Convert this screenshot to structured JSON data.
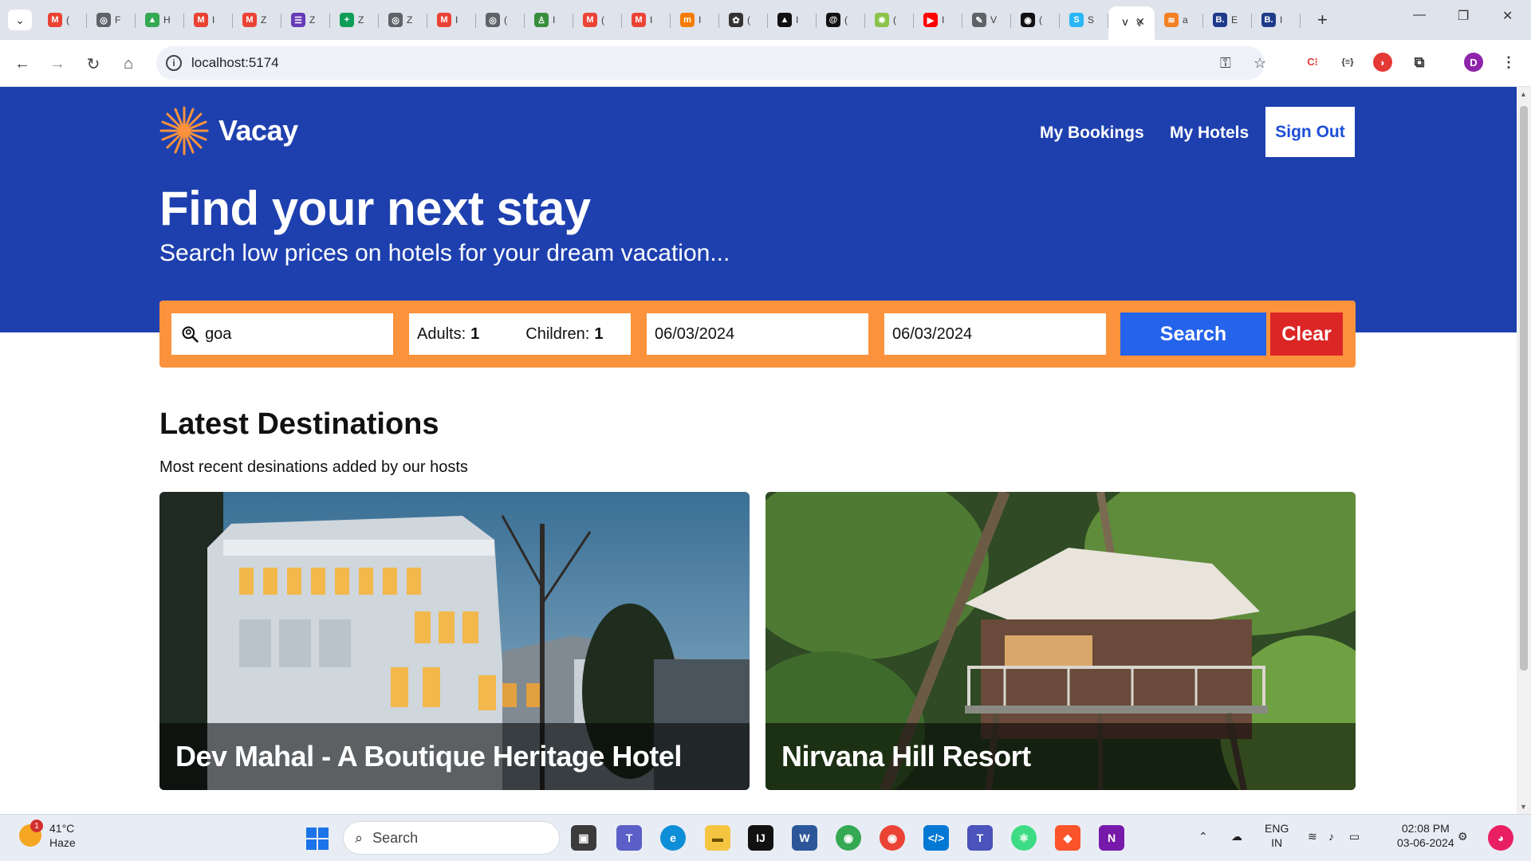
{
  "browser": {
    "tabs": [
      {
        "icon": "gmail-icon",
        "letter": "M",
        "label": "(",
        "color": "#ea4335"
      },
      {
        "icon": "globe-icon",
        "letter": "◎",
        "label": "F",
        "color": "#5f6368"
      },
      {
        "icon": "drive-icon",
        "letter": "▲",
        "label": "H",
        "color": "#34a853"
      },
      {
        "icon": "gmail-icon",
        "letter": "M",
        "label": "I",
        "color": "#ea4335"
      },
      {
        "icon": "gmail-icon",
        "letter": "M",
        "label": "Z",
        "color": "#ea4335"
      },
      {
        "icon": "forms-icon",
        "letter": "☰",
        "label": "Z",
        "color": "#673ab7"
      },
      {
        "icon": "sheets-icon",
        "letter": "+",
        "label": "Z",
        "color": "#0f9d58"
      },
      {
        "icon": "globe-icon",
        "letter": "◎",
        "label": "Z",
        "color": "#5f6368"
      },
      {
        "icon": "gmail-icon",
        "letter": "M",
        "label": "I",
        "color": "#ea4335"
      },
      {
        "icon": "globe-icon",
        "letter": "◎",
        "label": "(",
        "color": "#5f6368"
      },
      {
        "icon": "bag-icon",
        "letter": "♙",
        "label": "I",
        "color": "#388e3c"
      },
      {
        "icon": "gmail-icon",
        "letter": "M",
        "label": "(",
        "color": "#ea4335"
      },
      {
        "icon": "gmail-icon",
        "letter": "M",
        "label": "I",
        "color": "#ea4335"
      },
      {
        "icon": "scaler-icon",
        "letter": "m",
        "label": "I",
        "color": "#f57c00"
      },
      {
        "icon": "openai-icon",
        "letter": "✿",
        "label": "(",
        "color": "#333333"
      },
      {
        "icon": "vercel-icon",
        "letter": "▲",
        "label": "I",
        "color": "#111111"
      },
      {
        "icon": "threads-icon",
        "letter": "@",
        "label": "(",
        "color": "#111111"
      },
      {
        "icon": "leaf-icon",
        "letter": "❋",
        "label": "(",
        "color": "#8bc34a"
      },
      {
        "icon": "youtube-icon",
        "letter": "▶",
        "label": "I",
        "color": "#ff0000"
      },
      {
        "icon": "edit-icon",
        "letter": "✎",
        "label": "V",
        "color": "#5f6368"
      },
      {
        "icon": "github-icon",
        "letter": "◉",
        "label": "(",
        "color": "#111111"
      },
      {
        "icon": "stripe-icon",
        "letter": "S",
        "label": "S",
        "color": "#29b6f6"
      },
      {
        "icon": "vacay-icon",
        "letter": "V",
        "label": "V",
        "color": "#ffffff"
      },
      {
        "icon": "stack-icon",
        "letter": "≋",
        "label": "a",
        "color": "#f48024"
      },
      {
        "icon": "booking-icon",
        "letter": "B.",
        "label": "E",
        "color": "#1e3a8a"
      },
      {
        "icon": "booking-icon",
        "letter": "B.",
        "label": "I",
        "color": "#1e3a8a"
      }
    ],
    "active_tab_index": 22,
    "url": "localhost:5174"
  },
  "app": {
    "logo_text": "Vacay",
    "nav": {
      "bookings": "My Bookings",
      "hotels": "My Hotels",
      "signout": "Sign Out"
    },
    "hero": {
      "title": "Find your next stay",
      "subtitle": "Search low prices on hotels for your dream vacation..."
    },
    "search": {
      "destination": "goa",
      "adults_label": "Adults:",
      "adults": "1",
      "children_label": "Children:",
      "children": "1",
      "check_in": "06/03/2024",
      "check_out": "06/03/2024",
      "search_button": "Search",
      "clear_button": "Clear"
    },
    "latest": {
      "title": "Latest Destinations",
      "subtitle": "Most recent desinations added by our hosts",
      "cards": [
        {
          "name": "Dev Mahal - A Boutique Heritage Hotel"
        },
        {
          "name": "Nirvana Hill Resort"
        }
      ]
    },
    "colors": {
      "hero": "#1e40af",
      "search_bar": "#fb923c",
      "search_btn": "#2563eb",
      "clear_btn": "#dc2626"
    }
  },
  "taskbar": {
    "weather_temp": "41°C",
    "weather_desc": "Haze",
    "weather_badge": "1",
    "search_placeholder": "Search",
    "lang_top": "ENG",
    "lang_bottom": "IN",
    "time": "02:08 PM",
    "date": "03-06-2024"
  }
}
